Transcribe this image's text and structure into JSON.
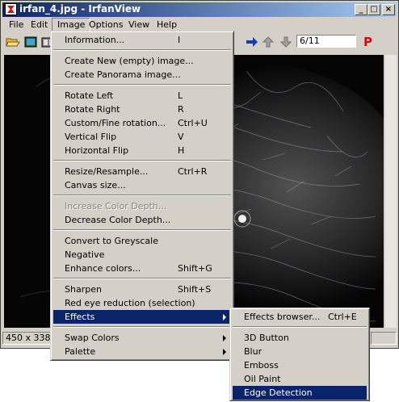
{
  "window": {
    "title": "irfan_4.jpg - IrfanView"
  },
  "menubar": [
    "File",
    "Edit",
    "Image",
    "Options",
    "View",
    "Help"
  ],
  "toolbar": {
    "page_field": "6/11",
    "p_label": "P"
  },
  "status": {
    "dimensions": "450 x 338 x"
  },
  "image_menu": [
    {
      "label": "Information...",
      "shortcut": "I"
    },
    {
      "label": "Create New (empty) image...",
      "shortcut": ""
    },
    {
      "label": "Create Panorama image...",
      "shortcut": ""
    },
    {
      "label": "Rotate Left",
      "shortcut": "L"
    },
    {
      "label": "Rotate Right",
      "shortcut": "R"
    },
    {
      "label": "Custom/Fine rotation...",
      "shortcut": "Ctrl+U"
    },
    {
      "label": "Vertical Flip",
      "shortcut": "V"
    },
    {
      "label": "Horizontal Flip",
      "shortcut": "H"
    },
    {
      "label": "Resize/Resample...",
      "shortcut": "Ctrl+R"
    },
    {
      "label": "Canvas size...",
      "shortcut": ""
    },
    {
      "label": "Increase Color Depth...",
      "shortcut": "",
      "disabled": true
    },
    {
      "label": "Decrease Color Depth...",
      "shortcut": ""
    },
    {
      "label": "Convert to Greyscale",
      "shortcut": ""
    },
    {
      "label": "Negative",
      "shortcut": ""
    },
    {
      "label": "Enhance colors...",
      "shortcut": "Shift+G"
    },
    {
      "label": "Sharpen",
      "shortcut": "Shift+S"
    },
    {
      "label": "Red eye reduction (selection)",
      "shortcut": ""
    },
    {
      "label": "Effects",
      "shortcut": "",
      "submenu": true,
      "selected": true
    },
    {
      "label": "Swap Colors",
      "shortcut": "",
      "submenu": true
    },
    {
      "label": "Palette",
      "shortcut": "",
      "submenu": true
    }
  ],
  "effects_menu": [
    {
      "label": "Effects browser...",
      "shortcut": "Ctrl+E"
    },
    {
      "label": "3D Button",
      "shortcut": ""
    },
    {
      "label": "Blur",
      "shortcut": ""
    },
    {
      "label": "Emboss",
      "shortcut": ""
    },
    {
      "label": "Oil Paint",
      "shortcut": ""
    },
    {
      "label": "Edge Detection",
      "shortcut": "",
      "selected": true
    }
  ]
}
